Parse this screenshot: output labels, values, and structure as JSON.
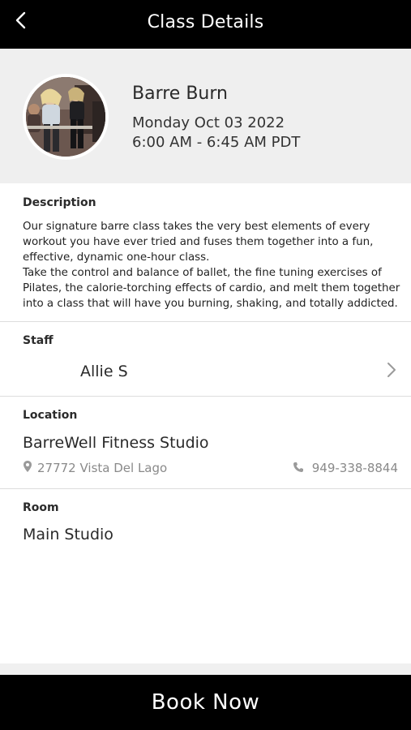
{
  "header": {
    "title": "Class Details",
    "back_icon": "chevron-left-icon"
  },
  "class": {
    "name": "Barre Burn",
    "date": "Monday Oct 03 2022",
    "time": "6:00 AM - 6:45 AM PDT",
    "image": "class-photo"
  },
  "description": {
    "label": "Description",
    "paragraphs": [
      "Our signature barre class takes the very best elements of every workout you have ever tried and fuses them together into a fun, effective, dynamic one-hour class.",
      "Take the control and balance of ballet, the fine tuning exercises of Pilates, the calorie-torching effects of cardio, and melt them together into a class that will have you burning, shaking, and totally addicted."
    ]
  },
  "staff": {
    "label": "Staff",
    "name": "Allie S",
    "icon": "chevron-right-icon"
  },
  "location": {
    "label": "Location",
    "name": "BarreWell Fitness Studio",
    "address": "27772 Vista Del Lago",
    "address_icon": "map-pin-icon",
    "phone": "949-338-8844",
    "phone_icon": "phone-icon"
  },
  "room": {
    "label": "Room",
    "name": "Main Studio"
  },
  "footer": {
    "book_label": "Book Now"
  },
  "colors": {
    "header_bg": "#000000",
    "hero_bg": "#efefef",
    "muted_text": "#8a8a8a",
    "button_bg": "#000000"
  }
}
